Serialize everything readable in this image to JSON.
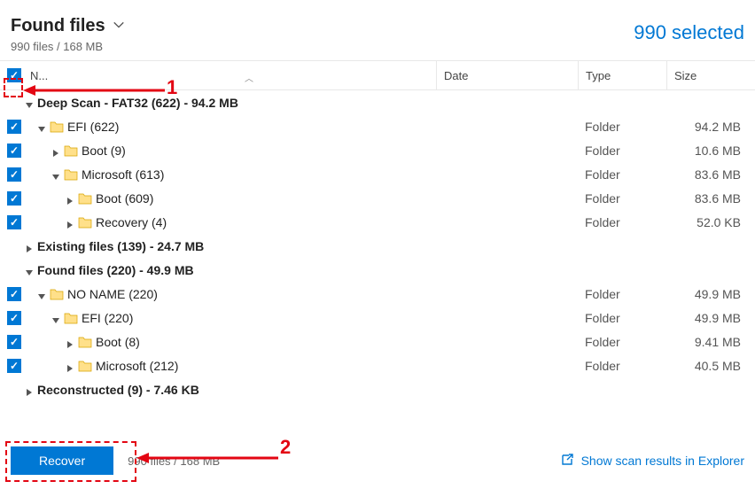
{
  "header": {
    "title": "Found files",
    "subtitle": "990 files / 168 MB",
    "selected_text": "990 selected"
  },
  "columns": {
    "name": "N...",
    "date": "Date",
    "type": "Type",
    "size": "Size"
  },
  "groups": [
    {
      "expanded": true,
      "label": "Deep Scan - FAT32 (622) - 94.2 MB"
    },
    {
      "expanded": false,
      "label": "Existing files (139) - 24.7 MB"
    },
    {
      "expanded": true,
      "label": "Found files (220) - 49.9 MB"
    },
    {
      "expanded": false,
      "label": "Reconstructed (9) - 7.46 KB"
    }
  ],
  "rows_g0": [
    {
      "indent": 1,
      "checked": true,
      "expanded": true,
      "name": "EFI (622)",
      "type": "Folder",
      "size": "94.2 MB"
    },
    {
      "indent": 2,
      "checked": true,
      "expanded": false,
      "name": "Boot (9)",
      "type": "Folder",
      "size": "10.6 MB"
    },
    {
      "indent": 2,
      "checked": true,
      "expanded": true,
      "name": "Microsoft (613)",
      "type": "Folder",
      "size": "83.6 MB"
    },
    {
      "indent": 3,
      "checked": true,
      "expanded": false,
      "name": "Boot (609)",
      "type": "Folder",
      "size": "83.6 MB"
    },
    {
      "indent": 3,
      "checked": true,
      "expanded": false,
      "name": "Recovery (4)",
      "type": "Folder",
      "size": "52.0 KB"
    }
  ],
  "rows_g2": [
    {
      "indent": 1,
      "checked": true,
      "expanded": true,
      "name": "NO NAME (220)",
      "type": "Folder",
      "size": "49.9 MB"
    },
    {
      "indent": 2,
      "checked": true,
      "expanded": true,
      "name": "EFI (220)",
      "type": "Folder",
      "size": "49.9 MB"
    },
    {
      "indent": 3,
      "checked": true,
      "expanded": false,
      "name": "Boot (8)",
      "type": "Folder",
      "size": "9.41 MB"
    },
    {
      "indent": 3,
      "checked": true,
      "expanded": false,
      "name": "Microsoft (212)",
      "type": "Folder",
      "size": "40.5 MB"
    }
  ],
  "footer": {
    "recover_label": "Recover",
    "summary": "990 files / 168 MB",
    "link_label": "Show scan results in Explorer"
  },
  "anno": {
    "one": "1",
    "two": "2"
  }
}
